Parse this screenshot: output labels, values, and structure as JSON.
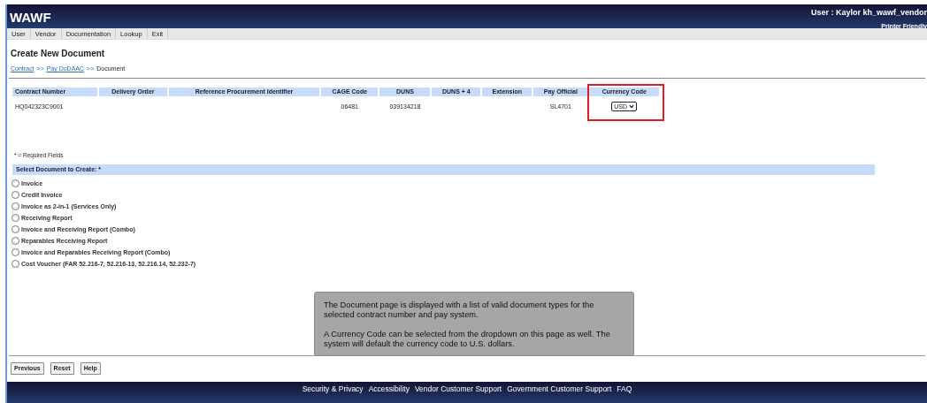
{
  "header": {
    "title": "WAWF",
    "user": "User : Kaylor kh_wawf_vendor",
    "printer_link": "Printer Friendly"
  },
  "menu": [
    {
      "label": "User"
    },
    {
      "label": "Vendor"
    },
    {
      "label": "Documentation"
    },
    {
      "label": "Lookup"
    },
    {
      "label": "Exit"
    }
  ],
  "page_title": "Create New Document",
  "breadcrumb": [
    {
      "kind": "link",
      "text": "Contract"
    },
    {
      "kind": "separator",
      "text": ">>"
    },
    {
      "kind": "link",
      "text": "Pay DoDAAC"
    },
    {
      "kind": "separator",
      "text": ">>"
    },
    {
      "kind": "current",
      "text": "Document"
    }
  ],
  "table": {
    "columns": [
      {
        "label": "Contract Number",
        "highlighted": false
      },
      {
        "label": "Delivery Order",
        "highlighted": false
      },
      {
        "label": "Reference Procurement Identifier",
        "highlighted": false
      },
      {
        "label": "CAGE Code",
        "highlighted": false
      },
      {
        "label": "DUNS",
        "highlighted": false
      },
      {
        "label": "DUNS + 4",
        "highlighted": false
      },
      {
        "label": "Extension",
        "highlighted": false
      },
      {
        "label": "Pay Official",
        "highlighted": false
      },
      {
        "label": "Currency Code",
        "highlighted": true
      }
    ],
    "row": [
      {
        "kind": "text",
        "value": "HQ042323C9001"
      },
      {
        "kind": "text"
      },
      {
        "kind": "text"
      },
      {
        "kind": "text",
        "value": "06481"
      },
      {
        "kind": "text",
        "value": "039134218"
      },
      {
        "kind": "text"
      },
      {
        "kind": "text"
      },
      {
        "kind": "text",
        "value": "SL4701"
      },
      {
        "kind": "select",
        "value": "USD"
      }
    ]
  },
  "required_note": "* = Required Fields",
  "section_title": "Select Document to Create: *",
  "document_types": [
    {
      "label": "Invoice",
      "selected": false
    },
    {
      "label": "Credit Invoice",
      "selected": false
    },
    {
      "label": "Invoice as 2-in-1 (Services Only)",
      "selected": false
    },
    {
      "label": "Receiving Report",
      "selected": false
    },
    {
      "label": "Invoice and Receiving Report (Combo)",
      "selected": false
    },
    {
      "label": "Reparables Receiving Report",
      "selected": false
    },
    {
      "label": "Invoice and Reparables Receiving Report (Combo)",
      "selected": false
    },
    {
      "label": "Cost Voucher (FAR 52.216-7, 52.216-13, 52.216.14, 52.232-7)",
      "selected": false
    }
  ],
  "callout": [
    "The Document page is displayed with a list of valid document types for the selected contract number and pay system.",
    "A Currency Code can be selected from the dropdown on this page as well. The system will default the currency code to U.S. dollars."
  ],
  "buttons": [
    "Previous",
    "Reset",
    "Help"
  ],
  "footer_links": [
    "Security & Privacy",
    "Accessibility",
    "Vendor Customer Support",
    "Government Customer Support",
    "FAQ"
  ]
}
